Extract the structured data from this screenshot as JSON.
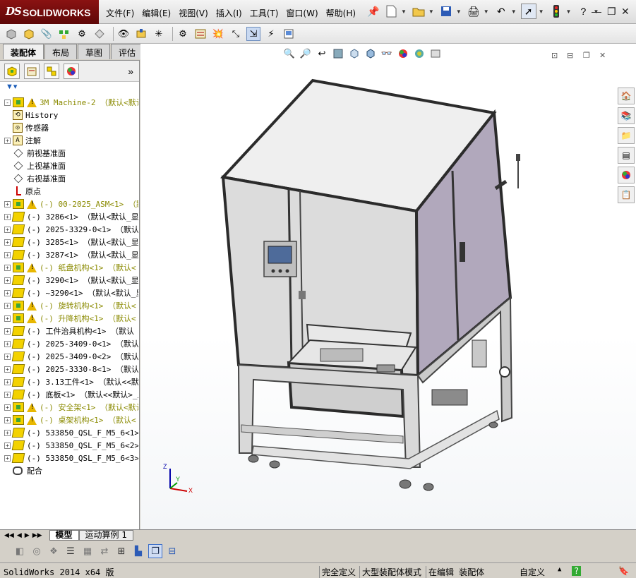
{
  "app": {
    "logo_mark": "DS",
    "logo_text": "SOLIDWORKS"
  },
  "menu": [
    "文件(F)",
    "编辑(E)",
    "视图(V)",
    "插入(I)",
    "工具(T)",
    "窗口(W)",
    "帮助(H)"
  ],
  "top_toolbar_icons": [
    "pin-icon",
    "new-document-icon",
    "open-icon",
    "save-icon",
    "print-icon",
    "undo-icon",
    "select-arrow-icon",
    "traffic-light-icon",
    "help-icon"
  ],
  "window_controls": [
    "minimize-icon",
    "restore-icon",
    "close-icon"
  ],
  "command_tabs": [
    "装配体",
    "布局",
    "草图",
    "评估"
  ],
  "active_command_tab": "装配体",
  "fm_tab_icons": [
    "feature-manager-icon",
    "property-manager-icon",
    "configuration-manager-icon",
    "display-manager-icon"
  ],
  "fm_more": "»",
  "tree": [
    {
      "type": "asm-warn",
      "expand": "-",
      "label": "3M Machine-2 （默认<默认_显"
    },
    {
      "type": "history",
      "expand": "",
      "label": "History"
    },
    {
      "type": "sensor",
      "expand": "",
      "label": "传感器"
    },
    {
      "type": "annotation",
      "expand": "+",
      "label": "注解"
    },
    {
      "type": "plane",
      "expand": "",
      "label": "前视基准面"
    },
    {
      "type": "plane",
      "expand": "",
      "label": "上视基准面"
    },
    {
      "type": "plane",
      "expand": "",
      "label": "右视基准面"
    },
    {
      "type": "origin",
      "expand": "",
      "label": "原点"
    },
    {
      "type": "asm-warn",
      "expand": "+",
      "label": "(-) 00-2025_ASM<1> （默认"
    },
    {
      "type": "part",
      "expand": "+",
      "label": "(-) 3286<1> （默认<默认_显"
    },
    {
      "type": "part",
      "expand": "+",
      "label": "(-) 2025-3329-0<1> （默认<"
    },
    {
      "type": "part",
      "expand": "+",
      "label": "(-) 3285<1> （默认<默认_显"
    },
    {
      "type": "part",
      "expand": "+",
      "label": "(-) 3287<1> （默认<默认_显"
    },
    {
      "type": "asm-warn",
      "expand": "+",
      "label": "(-) 纸盘机构<1> （默认<"
    },
    {
      "type": "part",
      "expand": "+",
      "label": "(-) 3290<1> （默认<默认_显"
    },
    {
      "type": "part",
      "expand": "+",
      "label": "(-) ~3290<1> （默认<默认_显"
    },
    {
      "type": "asm-warn",
      "expand": "+",
      "label": "(-) 旋转机构<1> （默认<"
    },
    {
      "type": "asm-warn",
      "expand": "+",
      "label": "(-) 升降机构<1> （默认<"
    },
    {
      "type": "part",
      "expand": "+",
      "label": "(-) 工件治具机构<1> （默认"
    },
    {
      "type": "part",
      "expand": "+",
      "label": "(-) 2025-3409-0<1> （默认<"
    },
    {
      "type": "part",
      "expand": "+",
      "label": "(-) 2025-3409-0<2> （默认<"
    },
    {
      "type": "part",
      "expand": "+",
      "label": "(-) 2025-3330-8<1> （默认<"
    },
    {
      "type": "part",
      "expand": "+",
      "label": "(-) 3.13工件<1> （默认<<默认"
    },
    {
      "type": "part",
      "expand": "+",
      "label": "(-) 底板<1> （默认<<默认>_显"
    },
    {
      "type": "asm-warn",
      "expand": "+",
      "label": "(-) 安全架<1> （默认<默认"
    },
    {
      "type": "asm-warn",
      "expand": "+",
      "label": "(-) 桌架机构<1> （默认<"
    },
    {
      "type": "part",
      "expand": "+",
      "label": "(-) 533850_QSL_F_M5_6<1>"
    },
    {
      "type": "part",
      "expand": "+",
      "label": "(-) 533850_QSL_F_M5_6<2>"
    },
    {
      "type": "part",
      "expand": "+",
      "label": "(-) 533850_QSL_F_M5_6<3>"
    },
    {
      "type": "mate",
      "expand": "",
      "label": "配合"
    }
  ],
  "bottom_tabs": [
    "模型",
    "运动算例 1"
  ],
  "active_bottom_tab": "模型",
  "status": {
    "app_version": "SolidWorks 2014 x64 版",
    "defined": "完全定义",
    "mode": "大型装配体模式",
    "editing": "在编辑 装配体",
    "units": "自定义",
    "help": "?"
  },
  "triad": {
    "x": "X",
    "y": "Y",
    "z": "Z"
  },
  "colors": {
    "title_red": "#7a0c0c",
    "panel_bg": "#d4d0c8",
    "machine_gray": "#d7d7d7",
    "machine_purple": "#b1a8bc",
    "frame_dark": "#2b2b2b",
    "warning_yellow": "#e8b700"
  }
}
